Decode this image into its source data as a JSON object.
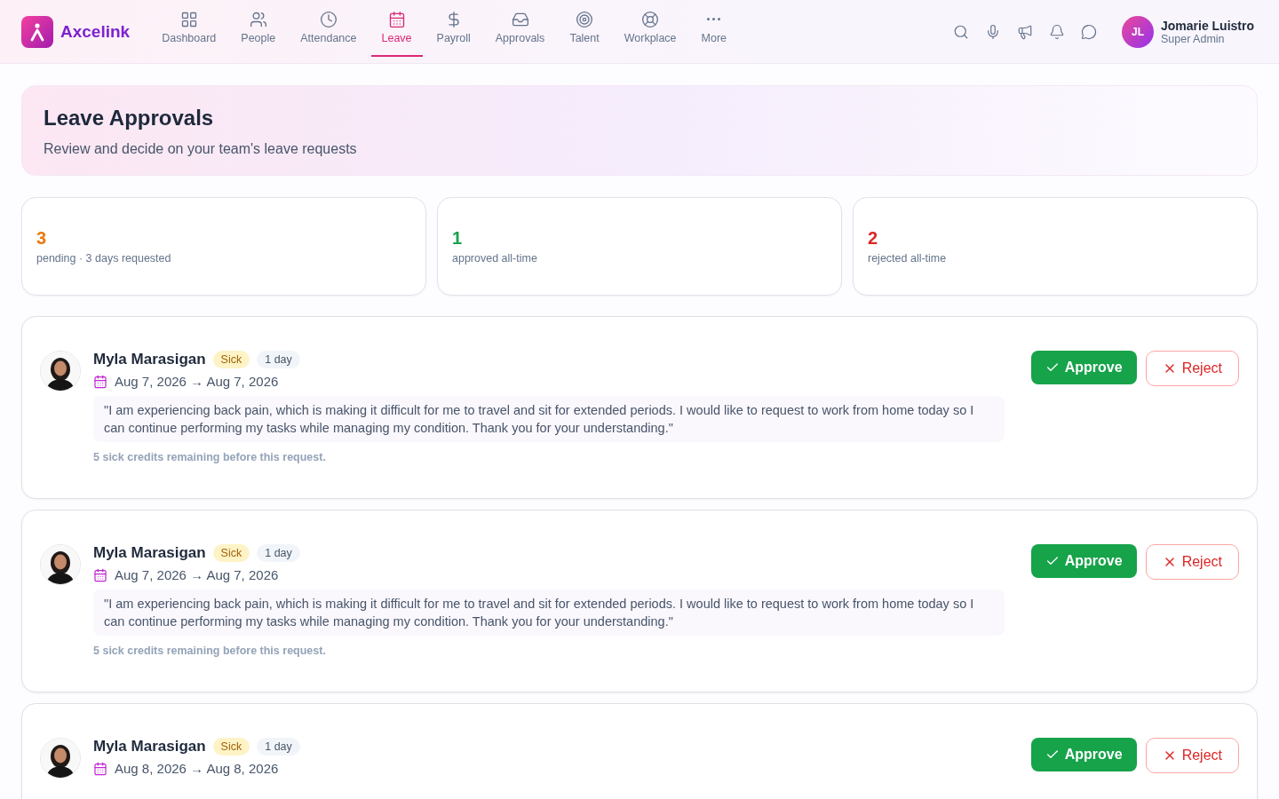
{
  "brand": {
    "name": "Axcelink"
  },
  "nav": [
    {
      "label": "Dashboard",
      "selected": false
    },
    {
      "label": "People",
      "selected": false
    },
    {
      "label": "Attendance",
      "selected": false
    },
    {
      "label": "Leave",
      "selected": true
    },
    {
      "label": "Payroll",
      "selected": false
    },
    {
      "label": "Approvals",
      "selected": false
    },
    {
      "label": "Talent",
      "selected": false
    },
    {
      "label": "Workplace",
      "selected": false
    },
    {
      "label": "More",
      "selected": false
    }
  ],
  "user": {
    "initials": "JL",
    "name": "Jomarie Luistro",
    "role": "Super Admin"
  },
  "page": {
    "title": "Leave Approvals",
    "subtitle": "Review and decide on your team's leave requests"
  },
  "stats": [
    {
      "value": "3",
      "label": "pending · 3 days requested",
      "color": "#ea7a0c"
    },
    {
      "value": "1",
      "label": "approved all-time",
      "color": "#16a34a"
    },
    {
      "value": "2",
      "label": "rejected all-time",
      "color": "#dc2626"
    }
  ],
  "requests": [
    {
      "name": "Myla Marasigan",
      "type": "Sick",
      "duration": "1 day",
      "dates": "Aug 7, 2026 → Aug 7, 2026",
      "reason": "\"I am experiencing back pain, which is making it difficult for me to travel and sit for extended periods. I would like to request to work from home today so I can continue performing my tasks while managing my condition. Thank you for your understanding.\"",
      "note": "5 sick credits remaining before this request.",
      "approve": "Approve",
      "reject": "Reject"
    },
    {
      "name": "Myla Marasigan",
      "type": "Sick",
      "duration": "1 day",
      "dates": "Aug 7, 2026 → Aug 7, 2026",
      "reason": "\"I am experiencing back pain, which is making it difficult for me to travel and sit for extended periods. I would like to request to work from home today so I can continue performing my tasks while managing my condition. Thank you for your understanding.\"",
      "note": "5 sick credits remaining before this request.",
      "approve": "Approve",
      "reject": "Reject"
    },
    {
      "name": "Myla Marasigan",
      "type": "Sick",
      "duration": "1 day",
      "dates": "Aug 8, 2026 → Aug 8, 2026",
      "approve": "Approve",
      "reject": "Reject"
    }
  ]
}
